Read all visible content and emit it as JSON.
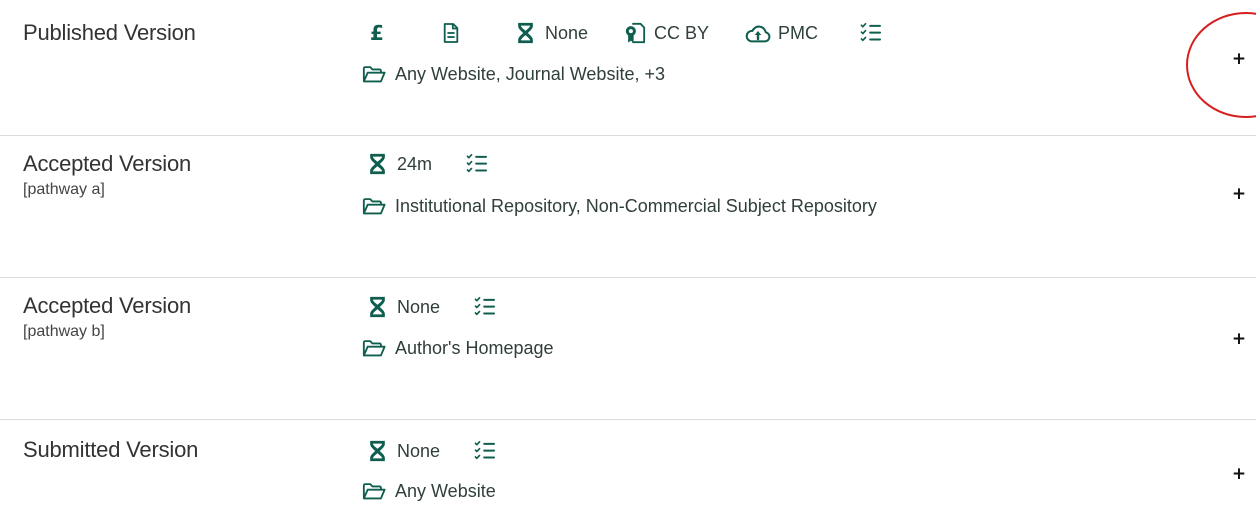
{
  "rows": [
    {
      "version": "Published Version",
      "pathway": "",
      "fee_icon": "pound-icon",
      "document_icon": "document-icon",
      "embargo": "None",
      "license": "CC BY",
      "deposit": "PMC",
      "conditions_icon": "checklist-icon",
      "locations": "Any Website, Journal Website, +3",
      "expand_label": "+"
    },
    {
      "version": "Accepted Version",
      "pathway": "[pathway a]",
      "embargo": "24m",
      "conditions_icon": "checklist-icon",
      "locations": "Institutional Repository, Non-Commercial Subject Repository",
      "expand_label": "+"
    },
    {
      "version": "Accepted Version",
      "pathway": "[pathway b]",
      "embargo": "None",
      "conditions_icon": "checklist-icon",
      "locations": "Author's Homepage",
      "expand_label": "+"
    },
    {
      "version": "Submitted Version",
      "pathway": "",
      "embargo": "None",
      "conditions_icon": "checklist-icon",
      "locations": "Any Website",
      "expand_label": "+"
    }
  ],
  "fee_symbol": "£",
  "colors": {
    "accent": "#0f5e4f",
    "highlight": "#d61f1f",
    "divider": "#dcdcdc"
  }
}
